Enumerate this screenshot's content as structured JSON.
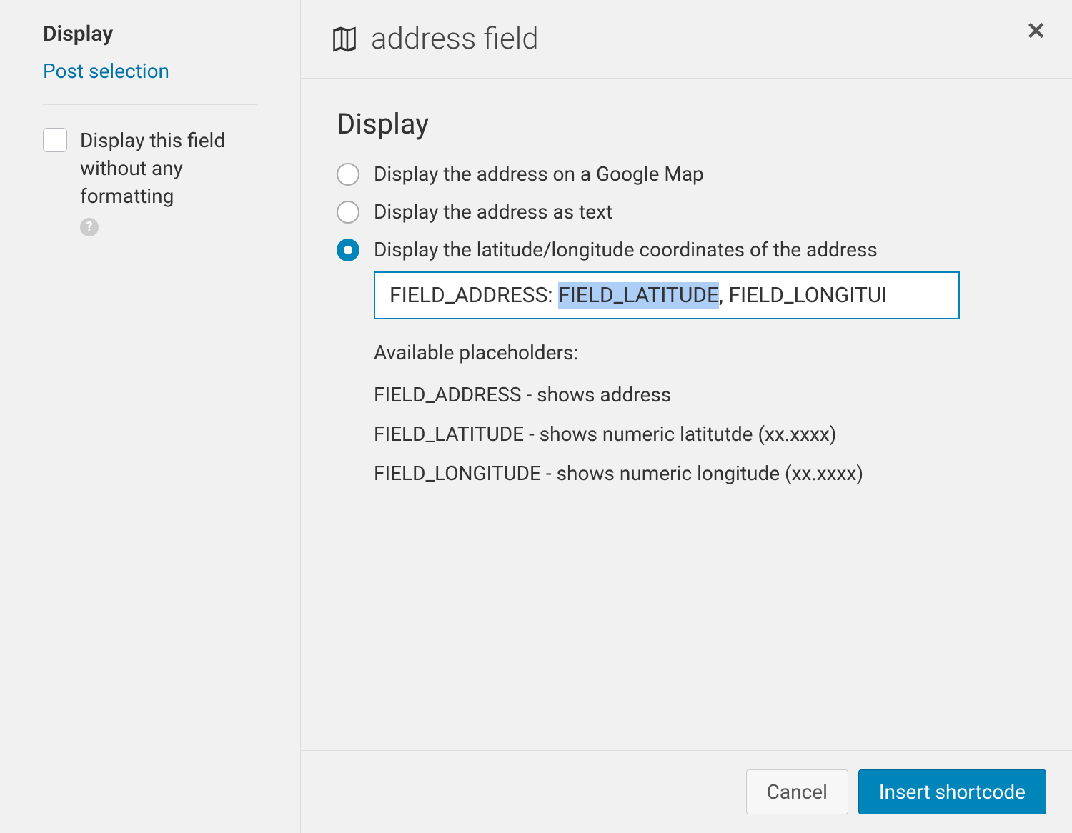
{
  "sidebar": {
    "title": "Display",
    "link_post_selection": "Post selection",
    "checkbox_label": "Display this field without any formatting"
  },
  "header": {
    "title": "address field"
  },
  "main": {
    "section_title": "Display",
    "radios": {
      "google_map": "Display the address on a Google Map",
      "as_text": "Display the address as text",
      "coordinates": "Display the latitude/longitude coordinates of the address"
    },
    "format_input": {
      "prefix": "FIELD_ADDRESS: ",
      "highlighted": "FIELD_LATITUDE",
      "suffix": ", FIELD_LONGITUI"
    },
    "placeholders_title": "Available placeholders:",
    "placeholders": [
      "FIELD_ADDRESS - shows address",
      "FIELD_LATITUDE - shows numeric latitutde (xx.xxxx)",
      "FIELD_LONGITUDE - shows numeric longitude (xx.xxxx)"
    ]
  },
  "footer": {
    "cancel": "Cancel",
    "insert": "Insert shortcode"
  }
}
